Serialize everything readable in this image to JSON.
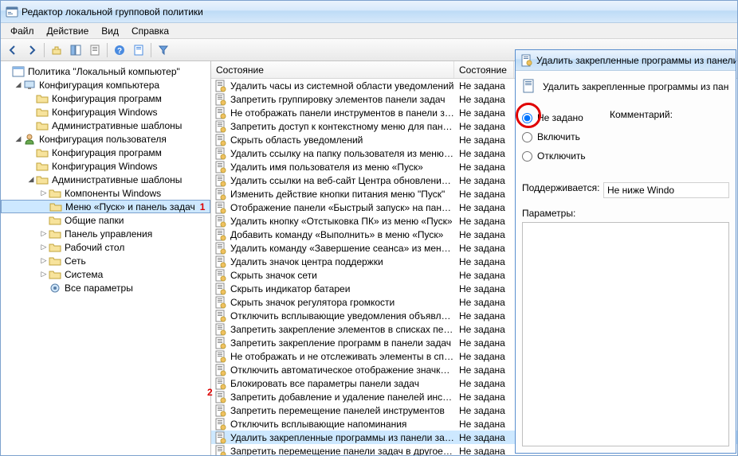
{
  "window": {
    "title": "Редактор локальной групповой политики"
  },
  "menu": {
    "file": "Файл",
    "action": "Действие",
    "view": "Вид",
    "help": "Справка"
  },
  "tree": {
    "root": "Политика \"Локальный компьютер\"",
    "cc": "Конфигурация компьютера",
    "cc_soft": "Конфигурация программ",
    "cc_win": "Конфигурация Windows",
    "cc_adm": "Административные шаблоны",
    "uc": "Конфигурация пользователя",
    "uc_soft": "Конфигурация программ",
    "uc_win": "Конфигурация Windows",
    "uc_adm": "Административные шаблоны",
    "comp_win": "Компоненты Windows",
    "start_taskbar": "Меню «Пуск» и панель задач",
    "shared": "Общие папки",
    "cp": "Панель управления",
    "desktop": "Рабочий стол",
    "network": "Сеть",
    "system": "Система",
    "all": "Все параметры"
  },
  "marker1": "1",
  "marker2": "2",
  "list": {
    "hdr_name": "Состояние",
    "hdr_state": "Состояние",
    "state_default": "Не задана",
    "items": [
      "Удалить часы из системной области уведомлений",
      "Запретить группировку элементов панели задач",
      "Не отображать панели инструментов в панели задач",
      "Запретить доступ к контекстному меню для панели за...",
      "Скрыть область уведомлений",
      "Удалить ссылку на папку пользователя из меню «Пуск»",
      "Удалить имя пользователя из меню «Пуск»",
      "Удалить ссылки на веб-сайт Центра обновления Wind...",
      "Изменить действие кнопки питания меню \"Пуск\"",
      "Отображение панели «Быстрый запуск» на панели зад...",
      "Удалить кнопку «Отстыковка ПК» из меню «Пуск»",
      "Добавить команду «Выполнить» в меню «Пуск»",
      "Удалить команду «Завершение сеанса» из меню «Пуск»",
      "Удалить значок центра поддержки",
      "Скрыть значок сети",
      "Скрыть индикатор батареи",
      "Скрыть значок регулятора громкости",
      "Отключить всплывающие уведомления объявлений к...",
      "Запретить закрепление элементов в списках переходов",
      "Запретить закрепление программ в панели задач",
      "Не отображать и не отслеживать элементы в списках п...",
      "Отключить автоматическое отображение значков уве...",
      "Блокировать все параметры панели задач",
      "Запретить добавление и удаление панелей инструмен...",
      "Запретить перемещение панелей инструментов",
      "Отключить всплывающие напоминания",
      "Удалить закрепленные программы из панели задач",
      "Запретить перемещение панели задач в другое полож..."
    ]
  },
  "dlg": {
    "title": "Удалить закрепленные программы из панели задач",
    "header": "Удалить закрепленные программы из панели зада",
    "r_notset": "Не задано",
    "r_enable": "Включить",
    "r_disable": "Отключить",
    "comment": "Комментарий:",
    "support_lbl": "Поддерживается:",
    "support_val": "Не ниже Windo",
    "params": "Параметры:"
  }
}
